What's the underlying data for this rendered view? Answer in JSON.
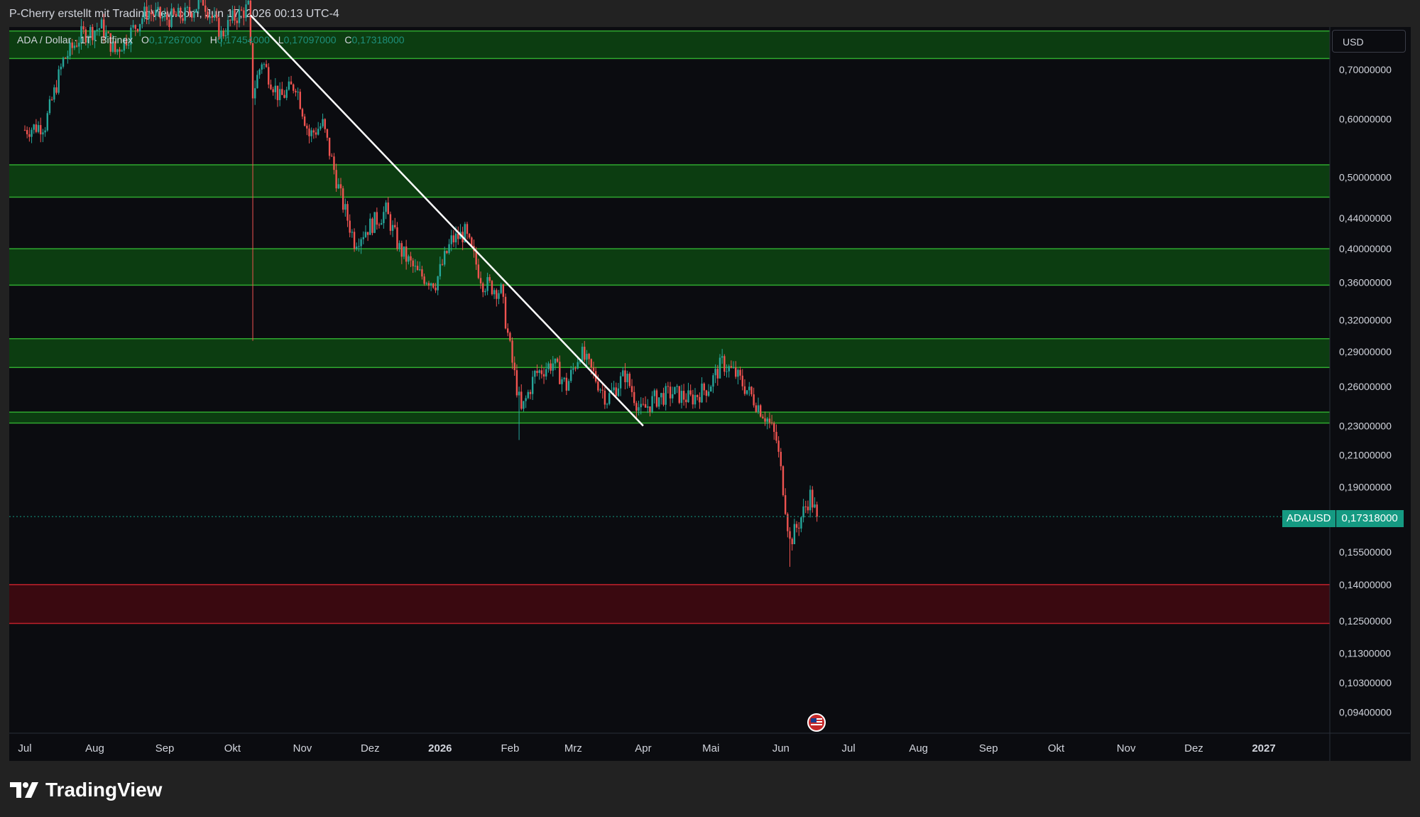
{
  "header": {
    "attribution": "P-Cherry erstellt mit TradingView.com, Jun 17, 2026 00:13 UTC-4"
  },
  "legend": {
    "symbol": "ADA / Dollar · 1T · Bitfinex",
    "open_label": "O",
    "open": "0,17267000",
    "high_label": "H",
    "high": "0,17454000",
    "low_label": "L",
    "low": "0,17097000",
    "close_label": "C",
    "close": "0,17318000"
  },
  "currency": "USD",
  "price_tag": {
    "symbol": "ADAUSD",
    "price": "0,17318000"
  },
  "brand": "TradingView",
  "colors": {
    "up": "#26a69a",
    "down": "#ef5350",
    "support_zone": "#0c3d11",
    "support_edge": "#2fa82f",
    "demand_zone": "#3a0910",
    "demand_edge": "#c2212b",
    "trendline": "#ffffff",
    "price_line": "#159a82"
  },
  "chart_data": {
    "type": "candlestick",
    "symbol": "ADAUSD",
    "interval": "1T",
    "exchange": "Bitfinex",
    "scale": "log",
    "y_axis": {
      "ticks": [
        0.7,
        0.6,
        0.5,
        0.44,
        0.4,
        0.36,
        0.32,
        0.29,
        0.26,
        0.23,
        0.21,
        0.19,
        0.155,
        0.14,
        0.125,
        0.113,
        0.103,
        0.094
      ],
      "tick_labels": [
        "0,70000000",
        "0,60000000",
        "0,50000000",
        "0,44000000",
        "0,40000000",
        "0,36000000",
        "0,32000000",
        "0,29000000",
        "0,26000000",
        "0,23000000",
        "0,21000000",
        "0,19000000",
        "0,15500000",
        "0,14000000",
        "0,12500000",
        "0,11300000",
        "0,10300000",
        "0,09400000"
      ],
      "range": [
        0.088,
        0.8
      ]
    },
    "x_axis": {
      "labels": [
        "Jul",
        "Aug",
        "Sep",
        "Okt",
        "Nov",
        "Dez",
        "2026",
        "Feb",
        "Mrz",
        "Apr",
        "Mai",
        "Jun",
        "Jul",
        "Aug",
        "Sep",
        "Okt",
        "Nov",
        "Dez",
        "2027"
      ],
      "months": [
        "2025-07",
        "2025-08",
        "2025-09",
        "2025-10",
        "2025-11",
        "2025-12",
        "2026-01",
        "2026-02",
        "2026-03",
        "2026-04",
        "2026-05",
        "2026-06",
        "2026-07",
        "2026-08",
        "2026-09",
        "2026-10",
        "2026-11",
        "2026-12",
        "2027-01"
      ]
    },
    "price_path": [
      [
        "2025-07-01",
        0.58
      ],
      [
        "2025-07-10",
        0.59
      ],
      [
        "2025-07-18",
        0.72
      ],
      [
        "2025-07-26",
        0.78
      ],
      [
        "2025-08-04",
        0.8
      ],
      [
        "2025-08-10",
        0.74
      ],
      [
        "2025-08-16",
        0.78
      ],
      [
        "2025-08-24",
        0.84
      ],
      [
        "2025-09-01",
        0.82
      ],
      [
        "2025-09-10",
        0.83
      ],
      [
        "2025-09-18",
        0.87
      ],
      [
        "2025-09-26",
        0.78
      ],
      [
        "2025-10-01",
        0.82
      ],
      [
        "2025-10-08",
        0.85
      ],
      [
        "2025-10-10",
        0.65
      ],
      [
        "2025-10-14",
        0.72
      ],
      [
        "2025-10-22",
        0.64
      ],
      [
        "2025-10-29",
        0.67
      ],
      [
        "2025-11-04",
        0.57
      ],
      [
        "2025-11-10",
        0.59
      ],
      [
        "2025-11-18",
        0.47
      ],
      [
        "2025-11-24",
        0.41
      ],
      [
        "2025-12-01",
        0.43
      ],
      [
        "2025-12-08",
        0.45
      ],
      [
        "2025-12-14",
        0.4
      ],
      [
        "2025-12-22",
        0.37
      ],
      [
        "2025-12-30",
        0.36
      ],
      [
        "2026-01-06",
        0.41
      ],
      [
        "2026-01-12",
        0.42
      ],
      [
        "2026-01-20",
        0.36
      ],
      [
        "2026-01-28",
        0.35
      ],
      [
        "2026-02-02",
        0.28
      ],
      [
        "2026-02-06",
        0.24
      ],
      [
        "2026-02-12",
        0.27
      ],
      [
        "2026-02-20",
        0.28
      ],
      [
        "2026-02-26",
        0.26
      ],
      [
        "2026-03-04",
        0.29
      ],
      [
        "2026-03-10",
        0.27
      ],
      [
        "2026-03-16",
        0.25
      ],
      [
        "2026-03-24",
        0.27
      ],
      [
        "2026-03-31",
        0.24
      ],
      [
        "2026-04-06",
        0.25
      ],
      [
        "2026-04-14",
        0.255
      ],
      [
        "2026-04-22",
        0.25
      ],
      [
        "2026-04-30",
        0.26
      ],
      [
        "2026-05-06",
        0.28
      ],
      [
        "2026-05-12",
        0.27
      ],
      [
        "2026-05-20",
        0.25
      ],
      [
        "2026-05-26",
        0.235
      ],
      [
        "2026-05-30",
        0.22
      ],
      [
        "2026-06-02",
        0.19
      ],
      [
        "2026-06-05",
        0.16
      ],
      [
        "2026-06-09",
        0.17
      ],
      [
        "2026-06-14",
        0.185
      ],
      [
        "2026-06-17",
        0.173
      ]
    ],
    "spikes": [
      {
        "date": "2025-10-10",
        "low": 0.3
      },
      {
        "date": "2026-02-05",
        "low": 0.22
      },
      {
        "date": "2026-06-05",
        "low": 0.148
      }
    ],
    "last_price": 0.17318,
    "zones": [
      {
        "kind": "support",
        "low": 0.725,
        "high": 0.79
      },
      {
        "kind": "support",
        "low": 0.47,
        "high": 0.52
      },
      {
        "kind": "support",
        "low": 0.357,
        "high": 0.4
      },
      {
        "kind": "support",
        "low": 0.276,
        "high": 0.302
      },
      {
        "kind": "support",
        "low": 0.232,
        "high": 0.24
      },
      {
        "kind": "demand",
        "low": 0.124,
        "high": 0.14
      }
    ],
    "trendline": {
      "start": [
        "2025-10-09",
        0.83
      ],
      "end": [
        "2026-04-01",
        0.23
      ]
    }
  }
}
